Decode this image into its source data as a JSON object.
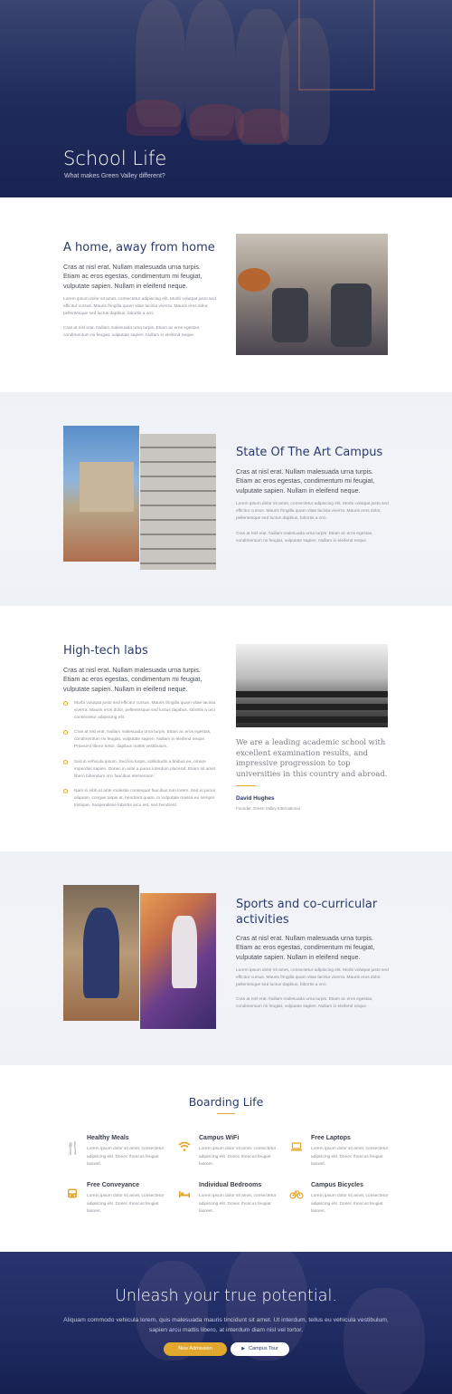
{
  "hero": {
    "title": "School Life",
    "subtitle": "What makes Green Valley different?"
  },
  "section1": {
    "heading": "A home, away from home",
    "lead": "Cras at nisl erat. Nullam malesuada urna turpis. Etiam ac eros egestas, condimentum mi feugiat, vulputate sapien. Nullam in eleifend neque.",
    "para1": "Lorem ipsum dolor sit amet, consectetur adipiscing elit. Morbi volutpat justo sed efficitur cursus. Mauris fringilla quam vitae lacinia viverra. Mauris eros dolor, pellentesque sed luctus dapibus, lobortis a orci.",
    "para2": "Cras at nisl erat. Nullam malesuada urna turpis. Etiam ac eros egestas, condimentum mi feugiat, vulputate sapien. Nullam in eleifend neque."
  },
  "section2": {
    "heading": "State Of The Art Campus",
    "lead": "Cras at nisl erat. Nullam malesuada urna turpis. Etiam ac eros egestas, condimentum mi feugiat, vulputate sapien. Nullam in eleifend neque.",
    "para1": "Lorem ipsum dolor sit amet, consectetur adipiscing elit. Morbi volutpat justo sed efficitur cursus. Mauris fringilla quam vitae lacinia viverra. Mauris eros dolor, pellentesque sed luctus dapibus, lobortis a orci.",
    "para2": "Cras at nisl erat. Nullam malesuada urna turpis. Etiam ac eros egestas, condimentum mi feugiat, vulputate sapien. Nullam in eleifend neque."
  },
  "section3": {
    "heading": "High-tech labs",
    "lead": "Cras at nisl erat. Nullam malesuada urna turpis. Etiam ac eros egestas, condimentum mi feugiat, vulputate sapien. Nullam in eleifend neque.",
    "bullets": [
      "Morbi volutpat justo sed efficitur cursus. Mauris fringilla quam vitae lacinia viverra. Mauris eros dolor, pellentesque sed luctus dapibus, lobortis a orci consectetur adipiscing elit.",
      "Cras at nisl erat. Nullam malesuada urna turpis. Etiam ac eros egestas, condimentum mi feugiat, vulputate sapien. Nullam in eleifend neque. Praesent libero tortor, dapibus mattis vestibulum.",
      "Sed in vehicula ipsum. Sed leo turpis, sollicitudin a finibus eu, ornare imperdiet sapien. Donec in ante a purus interdum placerat. Etiam sit amet libero bibendum orci faucibus elementum.",
      "Nam in nibh at ante molestie consequat faucibus non lorem. Sed et purus aliquam, congue turpis at, hendrerit quam. In vulputate massa eu semper tristique. Suspendisse lobortis arcu est, sed hendrerit."
    ],
    "quote": "We are a leading academic school with excellent examination results, and impressive progression to top universities in this country and abroad.",
    "quote_name": "David Hughes",
    "quote_role": "Founder, Green Valley International"
  },
  "section4": {
    "heading_line1": "Sports and co-curricular",
    "heading_line2": "activities",
    "lead": "Cras at nisl erat. Nullam malesuada urna turpis. Etiam ac eros egestas, condimentum mi feugiat, vulputate sapien. Nullam in eleifend neque.",
    "para1": "Lorem ipsum dolor sit amet, consectetur adipiscing elit. Morbi volutpat justo sed efficitur cursus. Mauris fringilla quam vitae lacinia viverra. Mauris eros dolor, pellentesque sed luctus dapibus, lobortis a orci.",
    "para2": "Cras at nisl erat. Nullam malesuada urna turpis. Etiam ac eros egestas, condimentum mi feugiat, vulputate sapien. Nullam in eleifend neque."
  },
  "boarding": {
    "title": "Boarding Life",
    "features": [
      {
        "title": "Healthy Meals",
        "icon": "utensils-icon",
        "desc": "Lorem ipsum dolor sit amet, consectetur adipiscing elit. Donec rhoncus feugiat laoreet."
      },
      {
        "title": "Campus WiFi",
        "icon": "wifi-icon",
        "desc": "Lorem ipsum dolor sit amet, consectetur adipiscing elit. Donec rhoncus feugiat laoreet."
      },
      {
        "title": "Free Laptops",
        "icon": "laptop-icon",
        "desc": "Lorem ipsum dolor sit amet, consectetur adipiscing elit. Donec rhoncus feugiat laoreet."
      },
      {
        "title": "Free Conveyance",
        "icon": "bus-icon",
        "desc": "Lorem ipsum dolor sit amet, consectetur adipiscing elit. Donec rhoncus feugiat laoreet."
      },
      {
        "title": "Individual Bedrooms",
        "icon": "bed-icon",
        "desc": "Lorem ipsum dolor sit amet, consectetur adipiscing elit. Donec rhoncus feugiat laoreet."
      },
      {
        "title": "Campus Bicycles",
        "icon": "bicycle-icon",
        "desc": "Lorem ipsum dolor sit amet, consectetur adipiscing elit. Donec rhoncus feugiat laoreet."
      }
    ]
  },
  "cta": {
    "title": "Unleash your true potential.",
    "text": "Aliquam commodo vehicula lorem, quis malesuada mauris tincidunt sit amet. Ut interdum, tellus eu vehicula vestibulum, sapien arcu mattis libero, at interdum diam nisl vel tortor.",
    "primary_label": "New Admission",
    "secondary_label": "Campus Tour"
  },
  "colors": {
    "navy": "#2a3a6c",
    "accent": "#e0a82e",
    "hero_bg": "#1d2a5a"
  }
}
